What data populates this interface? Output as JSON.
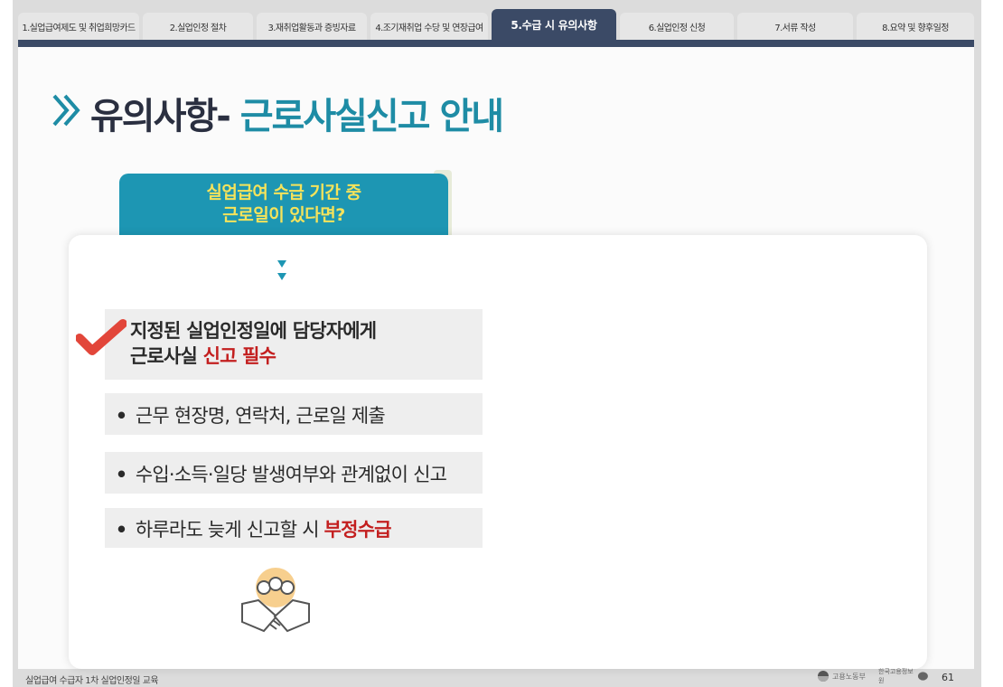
{
  "tabs": [
    {
      "label": "1.실업급여제도 및 취업희망카드",
      "active": false
    },
    {
      "label": "2.실업인정 절차",
      "active": false
    },
    {
      "label": "3.재취업활동과 증빙자료",
      "active": false
    },
    {
      "label": "4.조기재취업 수당 및 연장급여",
      "active": false
    },
    {
      "label": "5.수급 시 유의사항",
      "active": true
    },
    {
      "label": "6.실업인정 신청",
      "active": false
    },
    {
      "label": "7.서류 작성",
      "active": false
    },
    {
      "label": "8.요약 및 향후일정",
      "active": false
    }
  ],
  "title": {
    "prefix": "유의사항- ",
    "accent": "근로사실신고 안내"
  },
  "callout": {
    "line1": "실업급여 수급 기간 중",
    "line2": "근로일이 있다면?"
  },
  "items": {
    "item1_line1": "지정된 실업인정일에 담당자에게",
    "item1_line2_pre": "근로사실 ",
    "item1_line2_red": "신고 필수",
    "item2": "근무 현장명, 연락처, 근로일 제출",
    "item3": "수입·소득·일당 발생여부와 관계없이 신고",
    "item4_pre": "하루라도 늦게 신고할 시 ",
    "item4_red": "부정수급",
    "bullet": "•"
  },
  "footer": {
    "left": "실업급여 수급자 1차 실업인정일 교육",
    "logo1": "고용노동부",
    "logo2": "한국고용정보원",
    "page": "61"
  },
  "colors": {
    "tab_active": "#3b4a66",
    "accent": "#1e8ca5",
    "callout_bg": "#1d96b3",
    "callout_text": "#f5e35b",
    "red": "#c31f1f",
    "check": "#e2463a"
  },
  "icons": [
    "double-chevron-icon",
    "check-icon",
    "down-arrows-icon",
    "handshake-icon"
  ]
}
